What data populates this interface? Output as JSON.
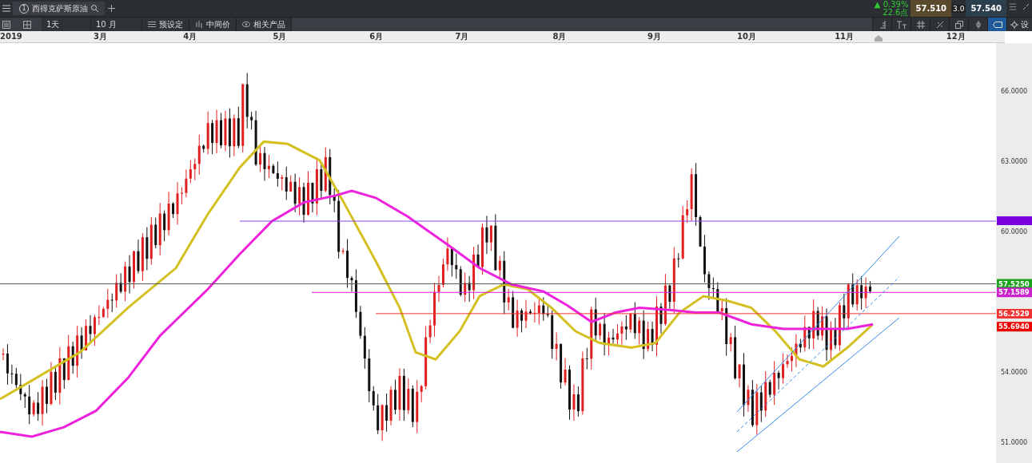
{
  "tabs": [
    {
      "number": "1",
      "label": "西得克萨斯原油",
      "selected": true
    }
  ],
  "quote": {
    "arrow": "▲",
    "change": "0.39%",
    "points": "22.6点",
    "sell": "57.510",
    "buy": "57.540",
    "spread": "3.0"
  },
  "toolbar": {
    "interval": "1天",
    "range": "10 月",
    "buttons": [
      {
        "kind": "preset",
        "label": "预设定"
      },
      {
        "kind": "mid",
        "label": "中间价"
      },
      {
        "kind": "related",
        "label": "相关产品"
      }
    ],
    "settings": "设"
  },
  "x_axis": [
    "2019",
    "3月",
    "4月",
    "5月",
    "6月",
    "7月",
    "8月",
    "9月",
    "10月",
    "11月",
    "12月"
  ],
  "y_axis": [
    "66.0000",
    "63.0000",
    "60.0000",
    "54.0000",
    "51.0000"
  ],
  "price_tags": [
    {
      "label": "57.5250",
      "color": "#1aa31a"
    },
    {
      "label": "57.1589",
      "color": "#cc22cc"
    },
    {
      "label": "56.2529",
      "color": "#ee3333"
    },
    {
      "label": "55.6940",
      "color": "#ee0000"
    }
  ]
}
